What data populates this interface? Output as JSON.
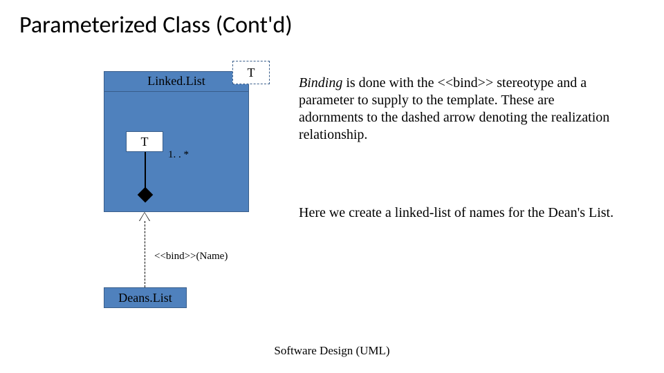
{
  "title": "Parameterized Class (Cont'd)",
  "uml": {
    "template_param": "T",
    "class_name": "Linked.List",
    "inner_class": "T",
    "multiplicity": "1. . *",
    "bind_stereotype": "<<bind>>(Name)",
    "bound_class": "Deans.List"
  },
  "desc": {
    "p1_lead": "Binding",
    "p1_rest": " is done with the <<bind>> stereotype and a parameter to supply to the template. These are adornments to the dashed arrow denoting the realization relationship.",
    "p2": "Here we create a linked-list of names for the Dean's List."
  },
  "footer": "Software Design (UML)"
}
